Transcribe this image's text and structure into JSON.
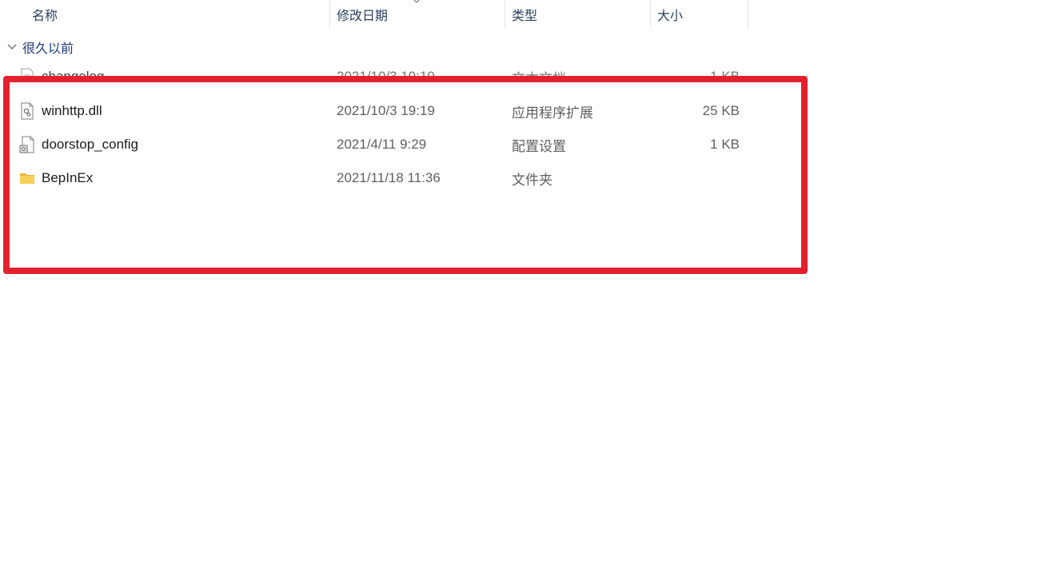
{
  "columns": {
    "name": "名称",
    "date": "修改日期",
    "type": "类型",
    "size": "大小"
  },
  "group": {
    "label": "很久以前"
  },
  "files": [
    {
      "name": "changelog",
      "date": "2021/10/3 19:19",
      "type": "文本文档",
      "size": "1 KB",
      "icon": "text-file-icon",
      "partially_hidden": true
    },
    {
      "name": "winhttp.dll",
      "date": "2021/10/3 19:19",
      "type": "应用程序扩展",
      "size": "25 KB",
      "icon": "dll-file-icon"
    },
    {
      "name": "doorstop_config",
      "date": "2021/4/11 9:29",
      "type": "配置设置",
      "size": "1 KB",
      "icon": "config-file-icon"
    },
    {
      "name": "BepInEx",
      "date": "2021/11/18 11:36",
      "type": "文件夹",
      "size": "",
      "icon": "folder-icon"
    }
  ],
  "colors": {
    "highlight": "#e3202e",
    "header_text": "#2a3f5c",
    "group_text": "#1c3b78",
    "folder": "#f5c542"
  }
}
